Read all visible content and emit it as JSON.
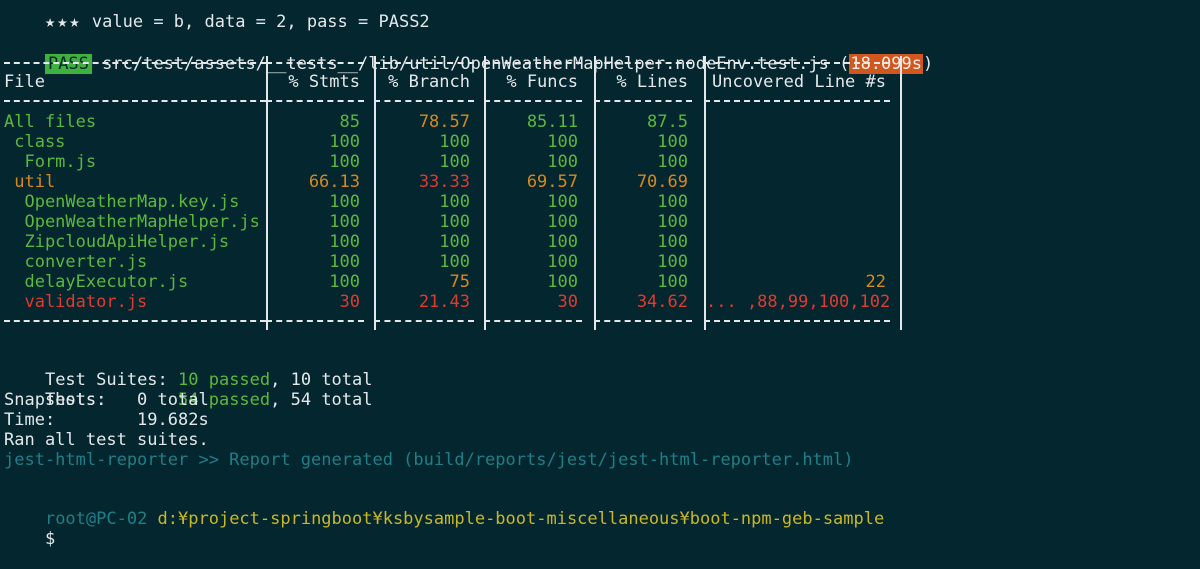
{
  "top_line": {
    "stars": "★★★",
    "text": " value = b, data = 2, pass = PASS2"
  },
  "result_line": {
    "badge": "PASS",
    "path": "src/test/assets/__tests__/lib/util/OpenWeatherMapHelper.nodeEnv.test.js",
    "paren_open": " (",
    "time": "18.099s",
    "paren_close": ")"
  },
  "coverage": {
    "headers": [
      "File",
      "% Stmts",
      "% Branch",
      "% Funcs",
      "% Lines",
      "Uncovered Line #s"
    ],
    "rows": [
      {
        "file": "All files",
        "stmts": "85",
        "branch": "78.57",
        "funcs": "85.11",
        "lines": "87.5",
        "uncovered": "",
        "colors": [
          "green",
          "green",
          "orange",
          "green",
          "green",
          "green"
        ]
      },
      {
        "file": " class",
        "stmts": "100",
        "branch": "100",
        "funcs": "100",
        "lines": "100",
        "uncovered": "",
        "colors": [
          "green",
          "green",
          "green",
          "green",
          "green",
          "green"
        ]
      },
      {
        "file": "  Form.js",
        "stmts": "100",
        "branch": "100",
        "funcs": "100",
        "lines": "100",
        "uncovered": "",
        "colors": [
          "green",
          "green",
          "green",
          "green",
          "green",
          "green"
        ]
      },
      {
        "file": " util",
        "stmts": "66.13",
        "branch": "33.33",
        "funcs": "69.57",
        "lines": "70.69",
        "uncovered": "",
        "colors": [
          "orange",
          "orange",
          "red",
          "orange",
          "orange",
          "orange"
        ]
      },
      {
        "file": "  OpenWeatherMap.key.js",
        "stmts": "100",
        "branch": "100",
        "funcs": "100",
        "lines": "100",
        "uncovered": "",
        "colors": [
          "green",
          "green",
          "green",
          "green",
          "green",
          "green"
        ]
      },
      {
        "file": "  OpenWeatherMapHelper.js",
        "stmts": "100",
        "branch": "100",
        "funcs": "100",
        "lines": "100",
        "uncovered": "",
        "colors": [
          "green",
          "green",
          "green",
          "green",
          "green",
          "green"
        ]
      },
      {
        "file": "  ZipcloudApiHelper.js",
        "stmts": "100",
        "branch": "100",
        "funcs": "100",
        "lines": "100",
        "uncovered": "",
        "colors": [
          "green",
          "green",
          "green",
          "green",
          "green",
          "green"
        ]
      },
      {
        "file": "  converter.js",
        "stmts": "100",
        "branch": "100",
        "funcs": "100",
        "lines": "100",
        "uncovered": "",
        "colors": [
          "green",
          "green",
          "green",
          "green",
          "green",
          "green"
        ]
      },
      {
        "file": "  delayExecutor.js",
        "stmts": "100",
        "branch": "75",
        "funcs": "100",
        "lines": "100",
        "uncovered": "22",
        "colors": [
          "green",
          "green",
          "orange",
          "green",
          "green",
          "orange"
        ]
      },
      {
        "file": "  validator.js",
        "stmts": "30",
        "branch": "21.43",
        "funcs": "30",
        "lines": "34.62",
        "uncovered": "... ,88,99,100,102",
        "colors": [
          "red",
          "red",
          "red",
          "red",
          "red",
          "red"
        ]
      }
    ]
  },
  "summary": {
    "suites_label": "Test Suites: ",
    "suites_passed": "10 passed",
    "suites_total": ", 10 total",
    "tests_label": "Tests:       ",
    "tests_passed": "54 passed",
    "tests_total": ", 54 total",
    "snapshots": "Snapshots:   0 total",
    "time": "Time:        19.682s",
    "ran": "Ran all test suites."
  },
  "reporter_line": "jest-html-reporter >> Report generated (build/reports/jest/jest-html-reporter.html)",
  "prompt": {
    "user": "root@PC-02",
    "path": " d:¥project-springboot¥ksbysample-boot-miscellaneous¥boot-npm-geb-sample",
    "symbol": "$"
  },
  "colors": {
    "background": "#04262f",
    "text": "#e4e8ea",
    "green": "#5cb83c",
    "orange": "#d9891a",
    "red": "#e23a2e",
    "teal": "#1f7f88",
    "pass_badge": "#3fb13f",
    "time_badge": "#d2571f"
  }
}
